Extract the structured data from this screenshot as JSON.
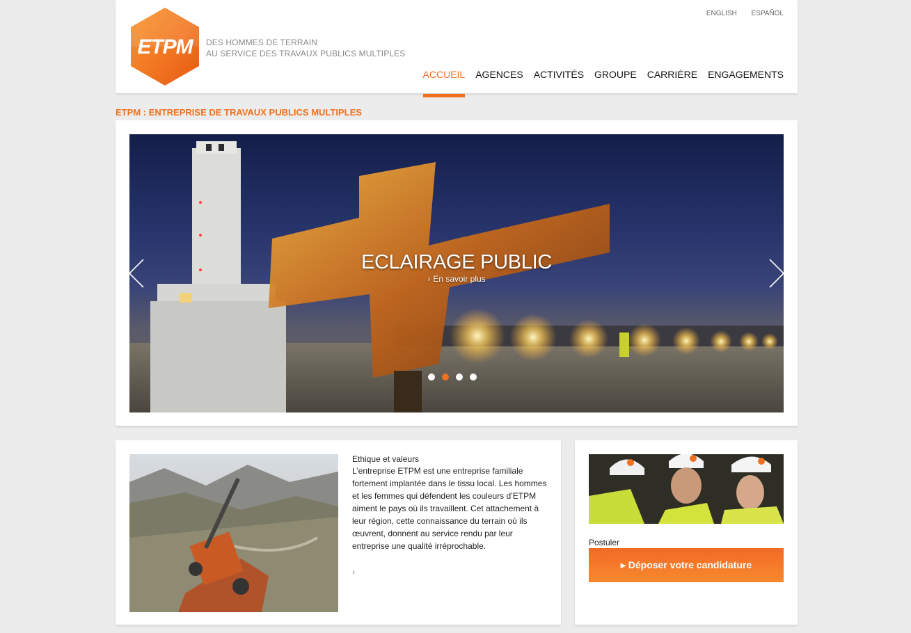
{
  "header": {
    "logo_text": "ETPM",
    "tagline_line1": "DES HOMMES DE TERRAIN",
    "tagline_line2": "AU SERVICE DES TRAVAUX PUBLICS MULTIPLES",
    "languages": [
      "ENGLISH",
      "ESPAÑOL"
    ],
    "nav": [
      {
        "label": "ACCUEIL",
        "active": true
      },
      {
        "label": "AGENCES",
        "active": false
      },
      {
        "label": "ACTIVITÉS",
        "active": false
      },
      {
        "label": "GROUPE",
        "active": false
      },
      {
        "label": "CARRIÈRE",
        "active": false
      },
      {
        "label": "ENGAGEMENTS",
        "active": false
      }
    ]
  },
  "section_title": "ETPM : ENTREPRISE DE TRAVAUX PUBLICS MULTIPLES",
  "slider": {
    "title": "ECLAIRAGE PUBLIC",
    "link": "En savoir plus",
    "dots": 4,
    "active_dot": 2
  },
  "ethics": {
    "heading": "Ethique et valeurs",
    "body": "L’entreprise ETPM est une entreprise familiale fortement implantée dans le tissu local. Les hommes et les femmes qui défendent les couleurs d’ETPM aiment le pays où ils travaillent. Cet attachement à leur région, cette connaissance du terrain où ils œuvrent, donnent au service rendu par leur entreprise une qualité irréprochable.",
    "more_icon": "chevron-right-icon"
  },
  "career": {
    "label": "Postuler",
    "button": "▸ Déposer votre candidature"
  },
  "colors": {
    "accent": "#f07020",
    "background": "#ececec",
    "panel": "#ffffff"
  }
}
